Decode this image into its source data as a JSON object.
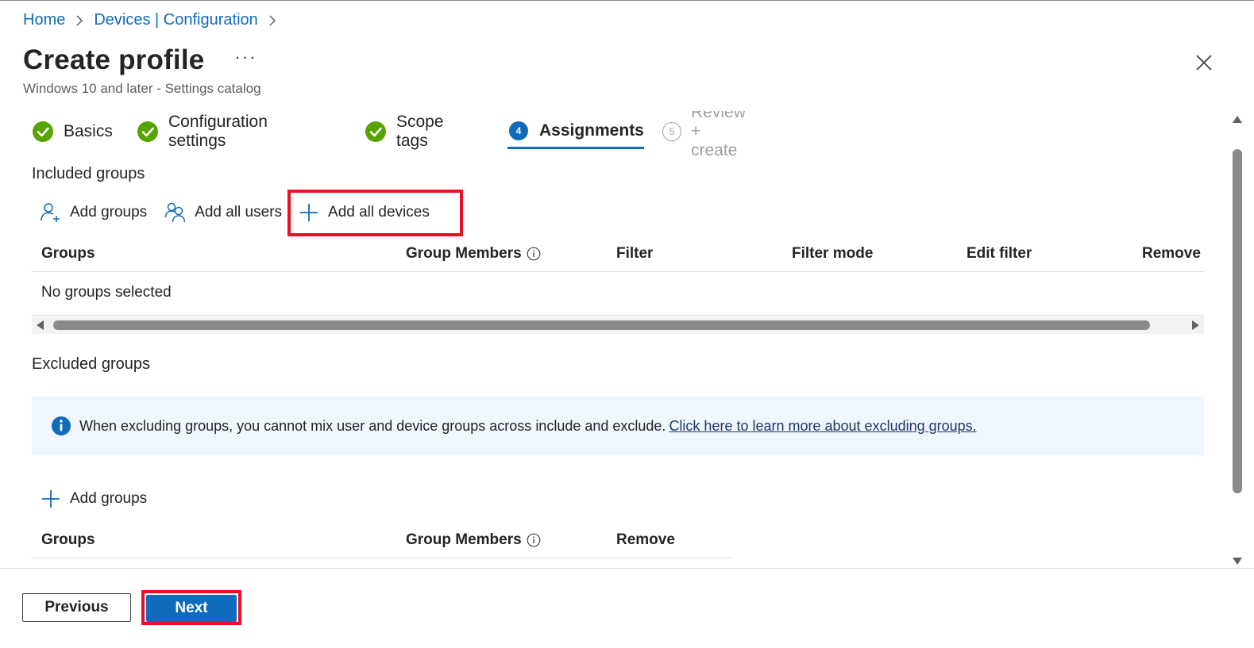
{
  "breadcrumb": {
    "items": [
      "Home",
      "Devices | Configuration"
    ]
  },
  "header": {
    "title": "Create profile",
    "more": "···",
    "subtitle": "Windows 10 and later - Settings catalog"
  },
  "tabs": [
    {
      "label": "Basics",
      "state": "complete"
    },
    {
      "label": "Configuration settings",
      "state": "complete"
    },
    {
      "label": "Scope tags",
      "state": "complete"
    },
    {
      "label": "Assignments",
      "state": "active",
      "step": "4"
    },
    {
      "label": "Review + create",
      "state": "pending",
      "step": "5"
    }
  ],
  "included": {
    "title": "Included groups",
    "actions": {
      "add_groups": "Add groups",
      "add_all_users": "Add all users",
      "add_all_devices": "Add all devices"
    },
    "columns": [
      "Groups",
      "Group Members",
      "Filter",
      "Filter mode",
      "Edit filter",
      "Remove"
    ],
    "empty_text": "No groups selected"
  },
  "excluded": {
    "title": "Excluded groups",
    "info_text": "When excluding groups, you cannot mix user and device groups across include and exclude.",
    "info_link": "Click here to learn more about excluding groups.",
    "add_groups": "Add groups",
    "columns": [
      "Groups",
      "Group Members",
      "Remove"
    ]
  },
  "footer": {
    "previous": "Previous",
    "next": "Next"
  },
  "colors": {
    "accent": "#0f6cbd",
    "success": "#57a300",
    "highlight": "#e81123",
    "info_bg": "#f0f6fd"
  }
}
